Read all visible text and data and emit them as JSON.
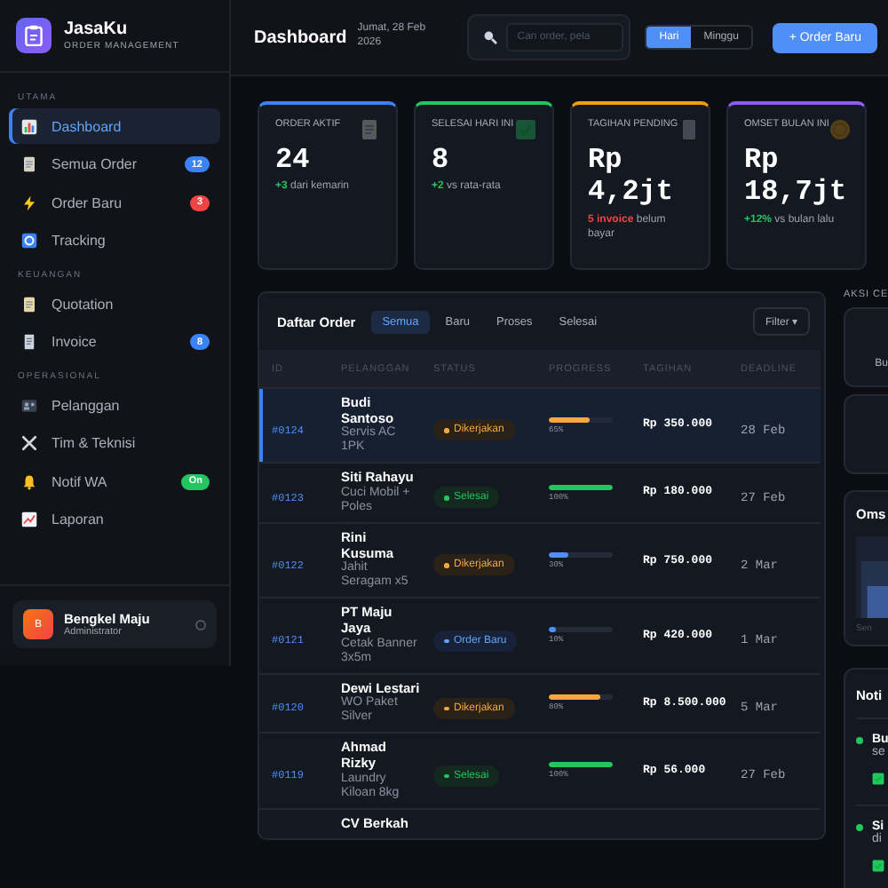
{
  "brand": {
    "name": "JasaKu",
    "tagline": "ORDER MANAGEMENT"
  },
  "sidebar": {
    "sections": [
      {
        "title": "UTAMA",
        "items": [
          {
            "label": "Dashboard",
            "selected": true
          },
          {
            "label": "Semua Order",
            "selected": false,
            "badge": "12",
            "color": "#3b82f6"
          },
          {
            "label": "Order Baru",
            "selected": false,
            "badge": "3",
            "color": "#ef4444"
          },
          {
            "label": "Tracking",
            "selected": false
          }
        ]
      },
      {
        "title": "KEUANGAN",
        "items": [
          {
            "label": "Quotation",
            "selected": false
          },
          {
            "label": "Invoice",
            "selected": false,
            "badge": "8",
            "color": "#3b82f6"
          }
        ]
      },
      {
        "title": "OPERASIONAL",
        "items": [
          {
            "label": "Pelanggan",
            "selected": false
          },
          {
            "label": "Tim & Teknisi",
            "selected": false
          },
          {
            "label": "Notif WA",
            "selected": false,
            "badge": "On",
            "color": "#22c55e"
          },
          {
            "label": "Laporan",
            "selected": false
          }
        ]
      }
    ],
    "user": {
      "initial": "B",
      "name": "Bengkel Maju",
      "role": "Administrator"
    }
  },
  "header": {
    "title": "Dashboard",
    "date": "Jumat, 28 Feb 2026",
    "search": {
      "placeholder": "Cari order, pela"
    },
    "range": [
      {
        "label": "Hari",
        "selected": true
      },
      {
        "label": "Minggu",
        "selected": false
      }
    ],
    "action": "+ Order Baru"
  },
  "stats": [
    {
      "label": "ORDER AKTIF",
      "value": "24",
      "color": "#3b82f6",
      "note": {
        "highlight": "+3",
        "text": " dari kemarin",
        "color": "#22c55e"
      }
    },
    {
      "label": "SELESAI HARI INI",
      "value": "8",
      "color": "#22c55e",
      "note": {
        "highlight": "+2",
        "text": " vs rata-rata",
        "color": "#22c55e"
      }
    },
    {
      "label": "TAGIHAN PENDING",
      "value": "Rp 4,2jt",
      "color": "#f59e0b",
      "note": {
        "highlight": "5 invoice",
        "text": " belum bayar",
        "color": "#ef4444"
      }
    },
    {
      "label": "OMSET BULAN INI",
      "value": "Rp 18,7jt",
      "color": "#8b5cf6",
      "note": {
        "highlight": "+12%",
        "text": " vs bulan lalu",
        "color": "#22c55e"
      }
    }
  ],
  "orders": {
    "title": "Daftar Order",
    "tabs": [
      {
        "label": "Semua",
        "selected": true
      },
      {
        "label": "Baru",
        "selected": false
      },
      {
        "label": "Proses",
        "selected": false
      },
      {
        "label": "Selesai",
        "selected": false
      }
    ],
    "filter": "Filter ▾",
    "columns": [
      "ID",
      "PELANGGAN",
      "STATUS",
      "PROGRESS",
      "TAGIHAN",
      "DEADLINE"
    ],
    "rows": [
      {
        "id": "#0124",
        "customer": "Budi Santoso",
        "service": "Servis AC 1PK",
        "status": "Dikerjakan",
        "kind": "working",
        "progress": {
          "level": 0.65,
          "reading": "65%",
          "color": "#f5a742"
        },
        "amount": "Rp 350.000",
        "deadline": "28 Feb",
        "selected": true
      },
      {
        "id": "#0123",
        "customer": "Siti Rahayu",
        "service": "Cuci Mobil + Poles",
        "status": "Selesai",
        "kind": "done",
        "progress": {
          "level": 1,
          "reading": "100%",
          "color": "#22c55e"
        },
        "amount": "Rp 180.000",
        "deadline": "27 Feb",
        "selected": false
      },
      {
        "id": "#0122",
        "customer": "Rini Kusuma",
        "service": "Jahit Seragam x5",
        "status": "Dikerjakan",
        "kind": "working",
        "progress": {
          "level": 0.3,
          "reading": "30%",
          "color": "#4f8ff7"
        },
        "amount": "Rp 750.000",
        "deadline": "2 Mar",
        "selected": false
      },
      {
        "id": "#0121",
        "customer": "PT Maju Jaya",
        "service": "Cetak Banner 3x5m",
        "status": "Order Baru",
        "kind": "new",
        "progress": {
          "level": 0.1,
          "reading": "10%",
          "color": "#4f8ff7"
        },
        "amount": "Rp 420.000",
        "deadline": "1 Mar",
        "selected": false
      },
      {
        "id": "#0120",
        "customer": "Dewi Lestari",
        "service": "WO Paket Silver",
        "status": "Dikerjakan",
        "kind": "working",
        "progress": {
          "level": 0.8,
          "reading": "80%",
          "color": "#f5a742"
        },
        "amount": "Rp 8.500.000",
        "deadline": "5 Mar",
        "selected": false
      },
      {
        "id": "#0119",
        "customer": "Ahmad Rizky",
        "service": "Laundry Kiloan 8kg",
        "status": "Selesai",
        "kind": "done",
        "progress": {
          "level": 1,
          "reading": "100%",
          "color": "#22c55e"
        },
        "amount": "Rp 56.000",
        "deadline": "27 Feb",
        "selected": false
      },
      {
        "customer": "CV Berkah"
      }
    ]
  },
  "side": {
    "label": "AKSI CE",
    "actions": [
      {
        "kind": "labeled",
        "text": "Bu"
      },
      {
        "kind": "blank"
      }
    ],
    "revenue": {
      "title": "Oms",
      "axis": "Sen"
    },
    "notifications": {
      "title": "Noti",
      "items": [
        {
          "title": "Bu",
          "sub": "se"
        },
        {
          "title": "Si",
          "sub": "di"
        }
      ]
    }
  }
}
